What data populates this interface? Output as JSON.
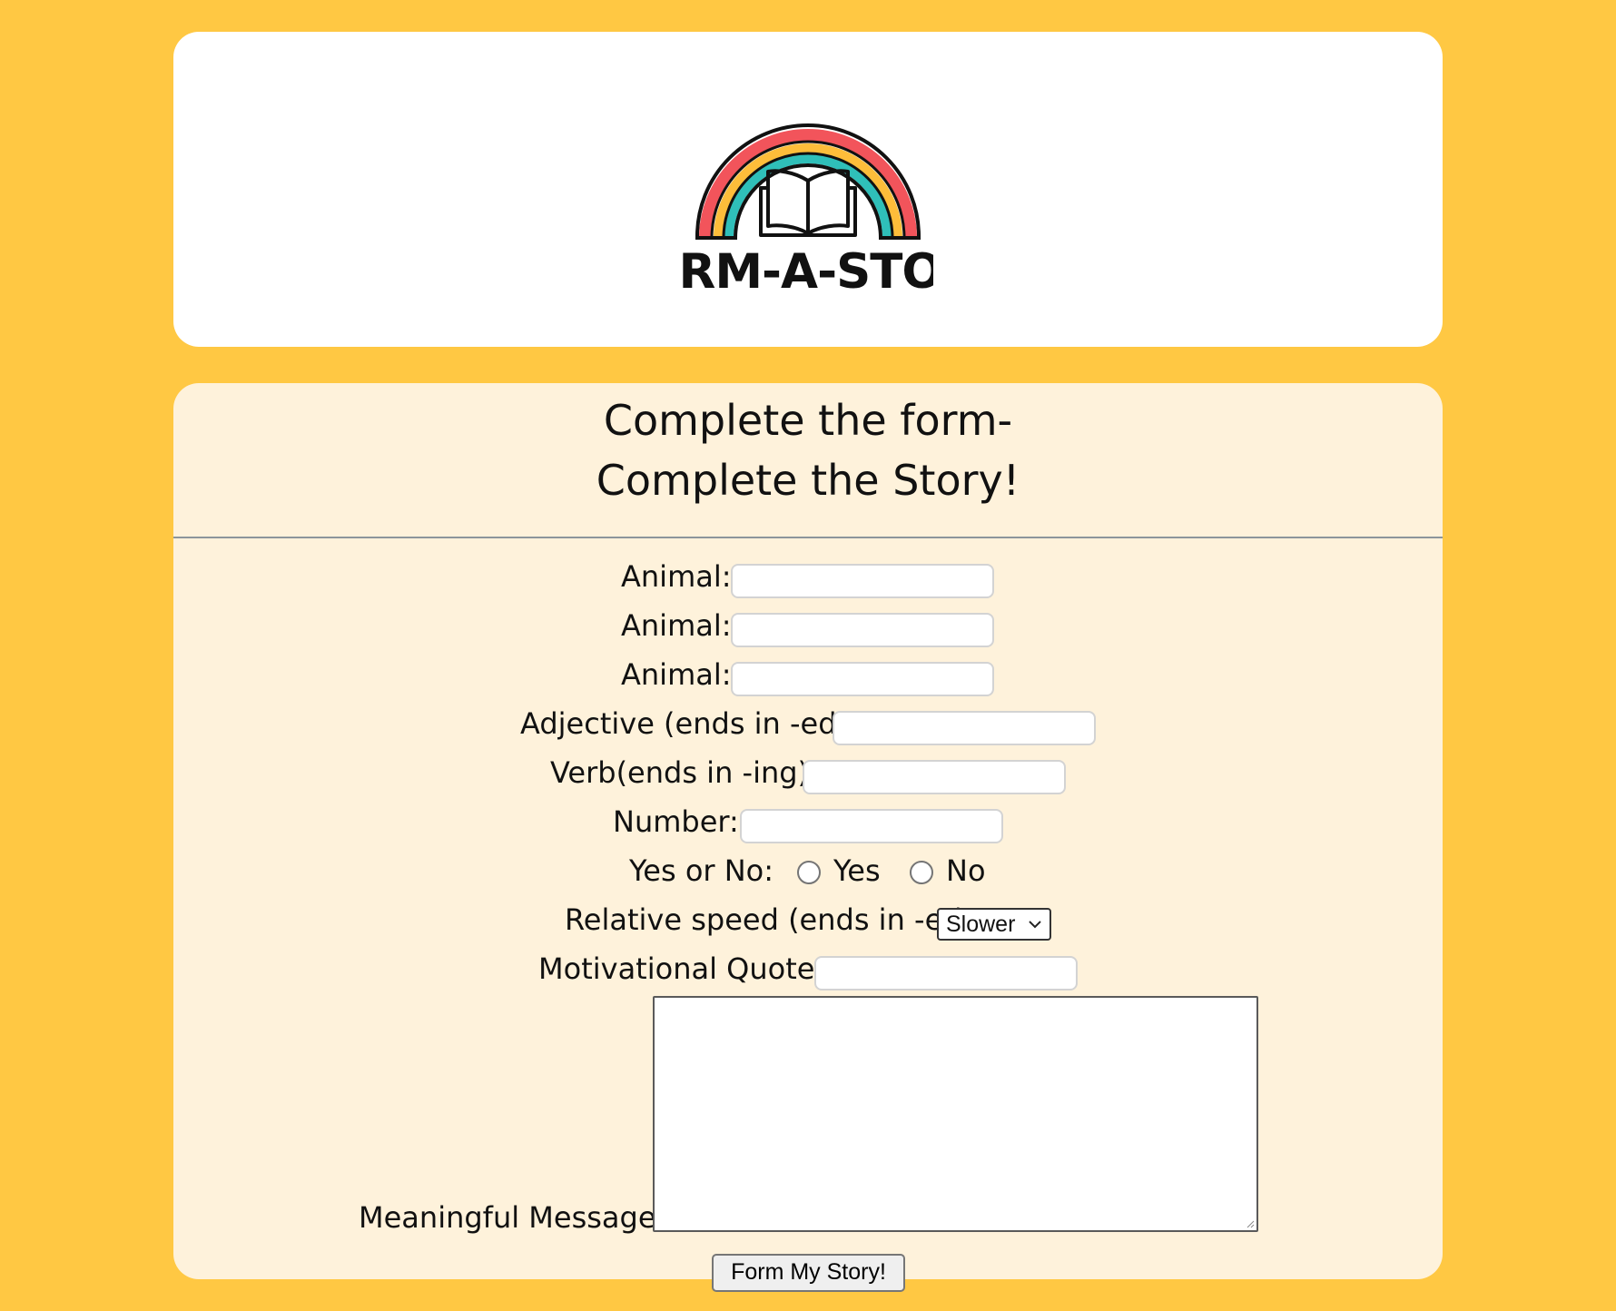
{
  "page": {
    "background_color": "#ffc843",
    "card_color": "#ffffff",
    "form_card_color": "#fef2db"
  },
  "header": {
    "logo_text": "FORM-A-STORY",
    "logo_icon": "rainbow-book-icon",
    "logo_colors": [
      "#f2545b",
      "#fdbd3a",
      "#2fbfb9"
    ]
  },
  "form": {
    "heading_line1": "Complete the form-",
    "heading_line2": "Complete the Story!",
    "fields": {
      "animal1_label": "Animal:",
      "animal2_label": "Animal:",
      "animal3_label": "Animal:",
      "adjective_label": "Adjective (ends in -ed):",
      "verb_label": "Verb(ends in -ing):",
      "number_label": "Number:",
      "yes_no_label": "Yes or No:",
      "yes_option": "Yes",
      "no_option": "No",
      "speed_label": "Relative speed (ends in -er)",
      "speed_selected": "Slower",
      "quote_label": "Motivational Quote:",
      "message_label": "Meaningful Message:"
    },
    "submit_label": "Form My Story!"
  }
}
